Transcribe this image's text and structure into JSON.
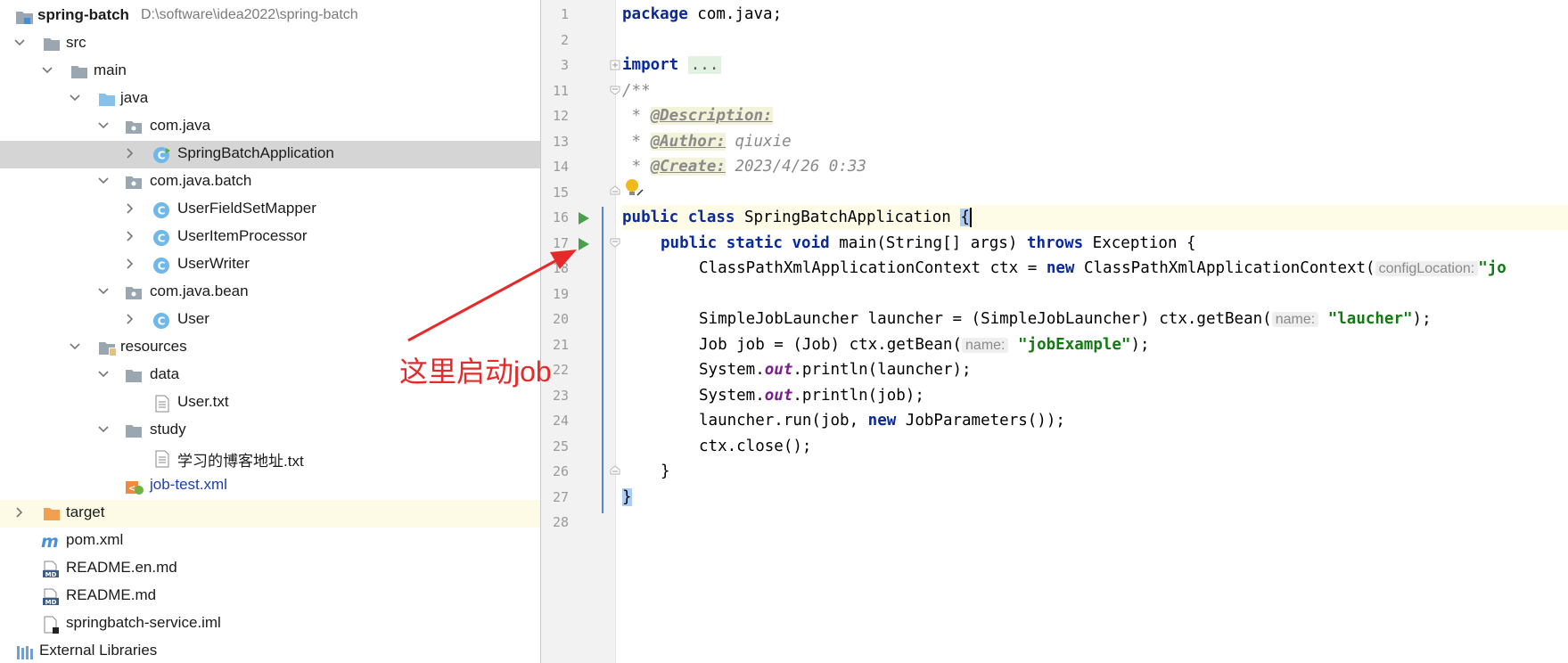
{
  "project": {
    "name": "spring-batch",
    "path": "D:\\software\\idea2022\\spring-batch"
  },
  "tree": [
    {
      "label": "src",
      "icon": "folder-icon"
    },
    {
      "label": "main",
      "icon": "folder-icon"
    },
    {
      "label": "java",
      "icon": "source-folder-icon"
    },
    {
      "label": "com.java",
      "icon": "package-icon"
    },
    {
      "label": "SpringBatchApplication",
      "icon": "spring-boot-class-icon"
    },
    {
      "label": "com.java.batch",
      "icon": "package-icon"
    },
    {
      "label": "UserFieldSetMapper",
      "icon": "class-icon"
    },
    {
      "label": "UserItemProcessor",
      "icon": "class-icon"
    },
    {
      "label": "UserWriter",
      "icon": "class-icon"
    },
    {
      "label": "com.java.bean",
      "icon": "package-icon"
    },
    {
      "label": "User",
      "icon": "class-icon"
    },
    {
      "label": "resources",
      "icon": "resources-folder-icon"
    },
    {
      "label": "data",
      "icon": "folder-icon"
    },
    {
      "label": "User.txt",
      "icon": "text-file-icon"
    },
    {
      "label": "study",
      "icon": "folder-icon"
    },
    {
      "label": "学习的博客地址.txt",
      "icon": "text-file-icon"
    },
    {
      "label": "job-test.xml",
      "icon": "spring-xml-icon"
    },
    {
      "label": "target",
      "icon": "excluded-folder-icon"
    },
    {
      "label": "pom.xml",
      "icon": "maven-icon"
    },
    {
      "label": "README.en.md",
      "icon": "markdown-icon"
    },
    {
      "label": "README.md",
      "icon": "markdown-icon"
    },
    {
      "label": "springbatch-service.iml",
      "icon": "iml-file-icon"
    },
    {
      "label": "External Libraries",
      "icon": "libraries-icon"
    }
  ],
  "editor": {
    "line_numbers": [
      "1",
      "2",
      "3",
      "11",
      "12",
      "13",
      "14",
      "15",
      "16",
      "17",
      "18",
      "19",
      "20",
      "21",
      "22",
      "23",
      "24",
      "25",
      "26",
      "27",
      "28"
    ],
    "code": {
      "l1_kw": "package",
      "l1_rest": " com.java;",
      "l3_kw": "import",
      "l3_folded": "...",
      "l11": "/**",
      "l12_star": " * ",
      "l12_tag": "@Description:",
      "l13_tag": "@Author:",
      "l13_val": " qiuxie",
      "l14_tag": "@Create:",
      "l14_val": " 2023/4/26 0:33",
      "l16_kw": "public class",
      "l16_name": " SpringBatchApplication ",
      "l16_brace": "{",
      "l17_kw1": "public static void",
      "l17_mid": " main(String[] args) ",
      "l17_kw2": "throws",
      "l17_end": " Exception {",
      "l18_a": "ClassPathXmlApplicationContext ctx = ",
      "l18_kw": "new",
      "l18_b": " ClassPathXmlApplicationContext(",
      "l18_hint": "configLocation:",
      "l18_str": "\"jo",
      "l20_a": "SimpleJobLauncher launcher = (SimpleJobLauncher) ctx.getBean(",
      "l20_hint": "name:",
      "l20_str": "\"laucher\"",
      "l20_end": ");",
      "l21_a": "Job job = (Job) ctx.getBean(",
      "l21_hint": "name:",
      "l21_str": "\"jobExample\"",
      "l21_end": ");",
      "l22_a": "System.",
      "l22_fld": "out",
      "l22_b": ".println(launcher);",
      "l23_a": "System.",
      "l23_fld": "out",
      "l23_b": ".println(job);",
      "l24_a": "launcher.run(job, ",
      "l24_kw": "new",
      "l24_b": " JobParameters());",
      "l25": "ctx.close();",
      "l26": "}",
      "l27": "}"
    }
  },
  "annotation": {
    "text": "这里启动job",
    "color": "#e62a2a"
  }
}
